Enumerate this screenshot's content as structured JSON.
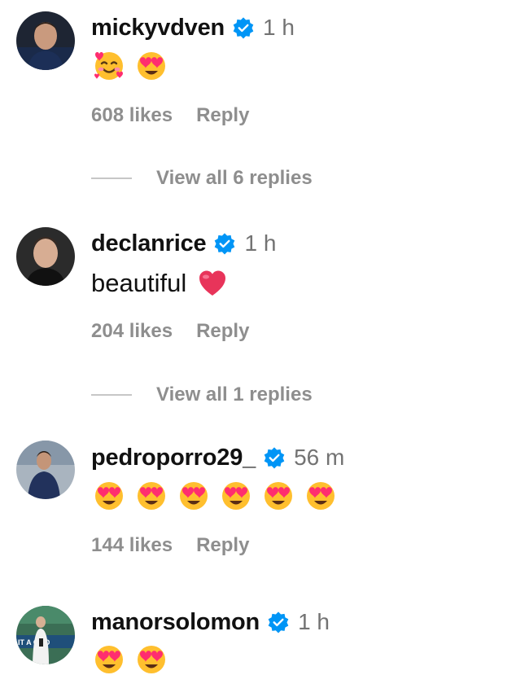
{
  "comments": [
    {
      "username": "mickyvdven",
      "time": "1 h",
      "emojis": [
        "smiling-face-with-hearts-icon",
        "heart-eyes-icon"
      ],
      "likes": "608 likes",
      "reply_label": "Reply",
      "view_replies": "View all 6 replies"
    },
    {
      "username": "declanrice",
      "time": "1 h",
      "text": "beautiful",
      "likes": "204 likes",
      "reply_label": "Reply",
      "view_replies": "View all 1 replies"
    },
    {
      "username": "pedroporro29_",
      "time": "56 m",
      "emojis": [
        "heart-eyes-icon",
        "heart-eyes-icon",
        "heart-eyes-icon",
        "heart-eyes-icon",
        "heart-eyes-icon",
        "heart-eyes-icon"
      ],
      "likes": "144 likes",
      "reply_label": "Reply"
    },
    {
      "username": "manorsolomon",
      "time": "1 h",
      "emojis": [
        "heart-eyes-icon",
        "heart-eyes-icon"
      ]
    }
  ],
  "avatar_4_jersey_text": "IT A  COO",
  "colors": {
    "verified_blue": "#0095f6",
    "text": "#111111",
    "muted": "#8e8e8e",
    "timestamp": "#737373",
    "heart": "#e8345a",
    "emoji_face": "#ffbf2e"
  }
}
